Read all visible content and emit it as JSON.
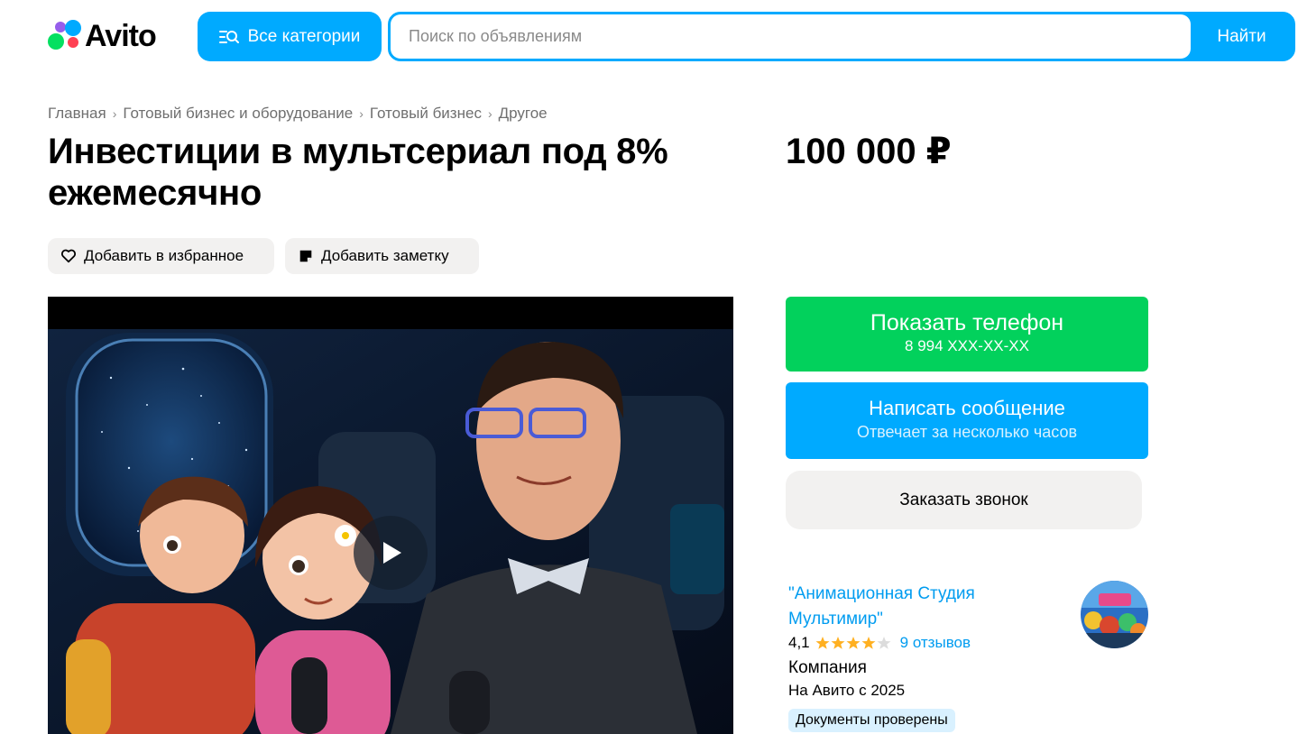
{
  "header": {
    "logo_text": "Avito",
    "categories_button": "Все категории",
    "search_placeholder": "Поиск по объявлениям",
    "search_value": "",
    "search_button": "Найти"
  },
  "breadcrumb": [
    "Главная",
    "Готовый бизнес и оборудование",
    "Готовый бизнес",
    "Другое"
  ],
  "listing": {
    "title": "Инвестиции в мультсериал под 8% ежемесячно",
    "price": "100 000 ₽",
    "add_favorite": "Добавить в избранное",
    "add_note": "Добавить заметку"
  },
  "contact": {
    "show_phone": "Показать телефон",
    "phone_masked": "8 994 XXX-XX-XX",
    "write_message": "Написать сообщение",
    "reply_time": "Отвечает за несколько часов",
    "order_call": "Заказать звонок"
  },
  "seller": {
    "name": "\"Анимационная Студия Мультимир\"",
    "rating": "4,1",
    "rating_value": 4.1,
    "rating_max": 5,
    "reviews": "9 отзывов",
    "type": "Компания",
    "since": "На Авито с 2025",
    "badge": "Документы проверены"
  },
  "colors": {
    "accent_blue": "#00aaff",
    "green": "#02d15c",
    "chip_bg": "#f2f1f0",
    "link_blue": "#009cf0",
    "star": "#ffb021"
  },
  "icons": [
    "logo-dots-icon",
    "categories-search-icon",
    "chevron-right-icon",
    "heart-icon",
    "note-icon",
    "play-icon",
    "star-icon"
  ]
}
